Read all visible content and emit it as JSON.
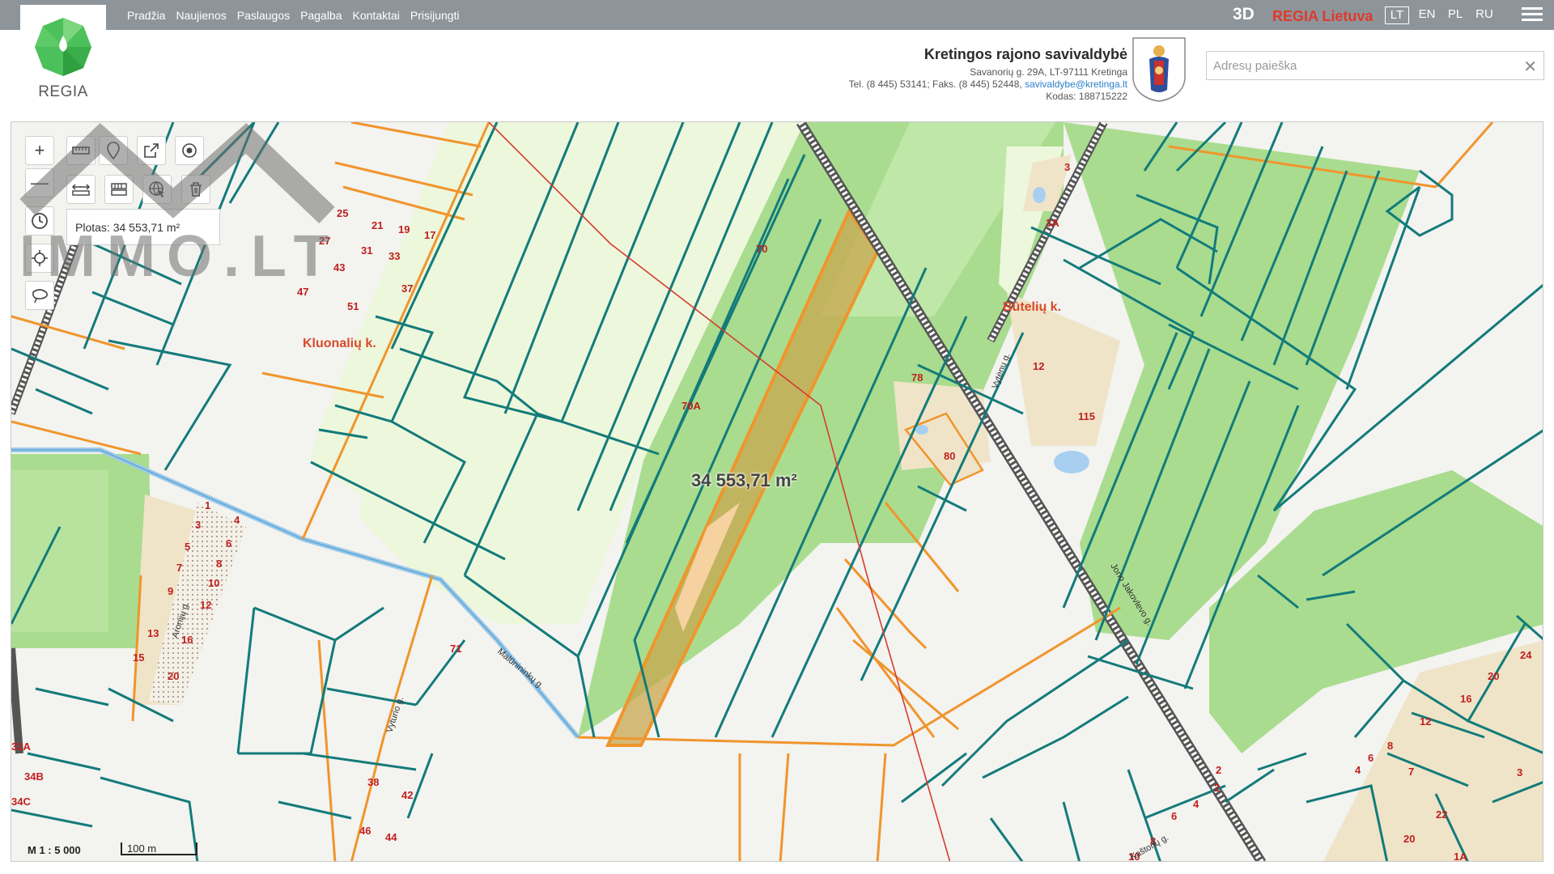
{
  "nav": {
    "items": [
      "Pradžia",
      "Naujienos",
      "Paslaugos",
      "Pagalba",
      "Kontaktai",
      "Prisijungti"
    ]
  },
  "logo": {
    "text": "REGIA"
  },
  "topright": {
    "btn_3d": "3D",
    "regia_lietuva": "REGIA Lietuva",
    "languages": [
      "LT",
      "EN",
      "PL",
      "RU"
    ],
    "active_language": "LT"
  },
  "municipality": {
    "title": "Kretingos rajono savivaldybė",
    "address": "Savanorių g. 29A, LT-97111 Kretinga",
    "phone_prefix": "Tel. (8 445) 53141; Faks. (8 445) 52448, ",
    "email": "savivaldybe@kretinga.lt",
    "code": "Kodas: 188715222"
  },
  "search": {
    "placeholder": "Adresų paieška",
    "value": ""
  },
  "map": {
    "area_panel": "Plotas: 34 553,71 m²",
    "area_label": "34 553,71 m²",
    "scale": "M 1 : 5 000",
    "scalebar": "100 m",
    "place_names": [
      "Kluonalių k.",
      "Būtelių k."
    ],
    "street_names": [
      "Malūnininkų g.",
      "Vyturio g.",
      "Aronijų g.",
      "Jono Jakovlevo g.",
      "Vytėnų g.",
      "Kaštonų g."
    ],
    "parcel_numbers": [
      "25",
      "21",
      "19",
      "17",
      "27",
      "31",
      "33",
      "43",
      "37",
      "47",
      "51",
      "70",
      "70A",
      "78",
      "80",
      "12",
      "115",
      "3",
      "3A",
      "1",
      "3",
      "4",
      "5",
      "6",
      "7",
      "8",
      "9",
      "10",
      "12",
      "13",
      "16",
      "15",
      "20",
      "71",
      "32A",
      "34B",
      "34C",
      "38",
      "42",
      "46",
      "44",
      "24",
      "20",
      "16",
      "12",
      "8",
      "6",
      "4",
      "2",
      "3",
      "7",
      "22",
      "20",
      "1A",
      "10",
      "8",
      "6",
      "4",
      "2"
    ],
    "watermark": "IMMO.LT"
  },
  "colors": {
    "topbar": "#8e959a",
    "parcel_line": "#137b7a",
    "road_orange": "#f0952c",
    "selected_fill": "#c9a74f",
    "forest": "#a9dc8f",
    "field": "#edf7dc",
    "built": "#efe4c8",
    "label_red": "#d02020"
  }
}
